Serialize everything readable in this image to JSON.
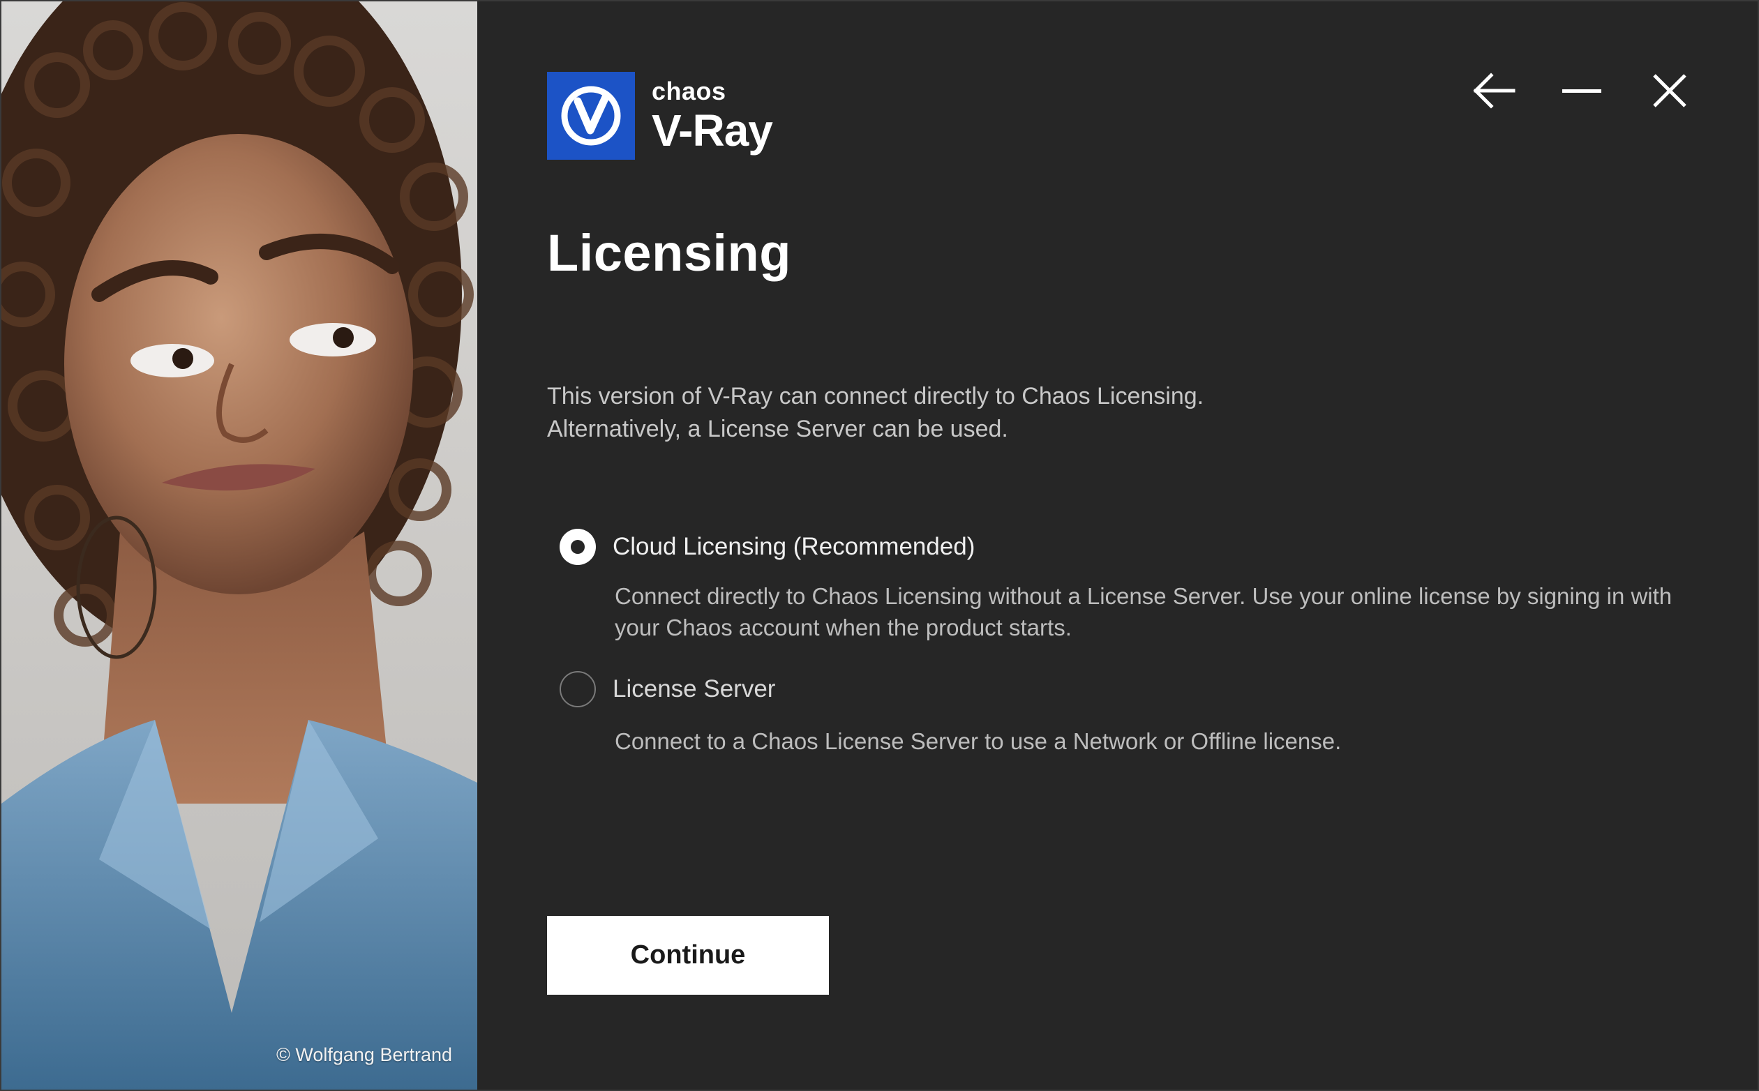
{
  "branding": {
    "brand": "chaos",
    "product": "V-Ray",
    "accent_color": "#1c53c6"
  },
  "window_controls": {
    "back_icon": "arrow-left-icon",
    "minimize_icon": "minimize-icon",
    "close_icon": "close-icon"
  },
  "illustration": {
    "subject": "stylized portrait",
    "credit": "© Wolfgang Bertrand"
  },
  "page": {
    "title": "Licensing",
    "description_line1": "This version of V-Ray can connect directly to Chaos Licensing.",
    "description_line2": "Alternatively, a License Server can be used."
  },
  "options": [
    {
      "label": "Cloud Licensing (Recommended)",
      "description": "Connect directly to Chaos Licensing without a License Server. Use your online license by signing in with your Chaos account when the product starts.",
      "selected": true
    },
    {
      "label": "License Server",
      "description": "Connect to a Chaos License Server to use a Network or Offline license.",
      "selected": false
    }
  ],
  "actions": {
    "continue_label": "Continue"
  }
}
